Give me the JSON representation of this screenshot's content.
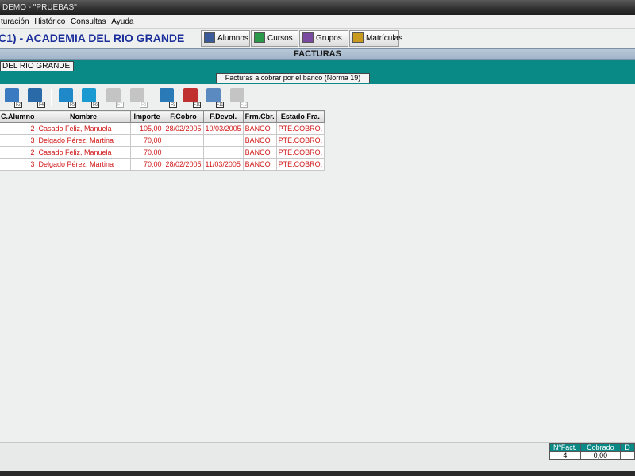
{
  "window": {
    "title": "DEMO - \"PRUEBAS\""
  },
  "menu": [
    "turación",
    "Histórico",
    "Consultas",
    "Ayuda"
  ],
  "header": {
    "title": "C1) - ACADEMIA DEL RIO GRANDE",
    "buttons": [
      {
        "label": "Alumnos",
        "icon": "students-icon",
        "color": "#3a5a9a"
      },
      {
        "label": "Cursos",
        "icon": "courses-icon",
        "color": "#2a9a4a"
      },
      {
        "label": "Grupos",
        "icon": "groups-icon",
        "color": "#7a4aa0"
      },
      {
        "label": "Matrículas",
        "icon": "enrollments-icon",
        "color": "#c89a20"
      }
    ]
  },
  "section": {
    "title": "FACTURAS"
  },
  "academy_tab": "DEL RIO GRANDE",
  "list_label": "Facturas a cobrar por el banco (Norma 19)",
  "toolbar": [
    {
      "key": "F2",
      "icon": "print-list-icon",
      "color": "#3a7ac0",
      "enabled": true
    },
    {
      "key": "F4",
      "icon": "sort-az-icon",
      "color": "#2a6aa8",
      "enabled": true
    },
    {
      "key": "F5",
      "icon": "edit-icon",
      "color": "#1e88c8",
      "enabled": true
    },
    {
      "key": "F6",
      "icon": "add-icon",
      "color": "#1a9ad0",
      "enabled": true
    },
    {
      "key": "F7",
      "icon": "disabled-action-icon",
      "color": "#c4c4c4",
      "enabled": false
    },
    {
      "key": "F8",
      "icon": "disabled-action-icon",
      "color": "#c4c4c4",
      "enabled": false
    },
    {
      "key": "F9",
      "icon": "export-icon",
      "color": "#2a7ab8",
      "enabled": true
    },
    {
      "key": "F10",
      "icon": "bank-remittance-icon",
      "color": "#c03030",
      "enabled": true
    },
    {
      "key": "F11",
      "icon": "printer-icon",
      "color": "#5a8ac0",
      "enabled": true
    },
    {
      "key": "F12",
      "icon": "disabled-action-icon",
      "color": "#c4c4c4",
      "enabled": false
    }
  ],
  "grid": {
    "columns": [
      "C.Alumno",
      "Nombre",
      "Importe",
      "F.Cobro",
      "F.Devol.",
      "Frm.Cbr.",
      "Estado Fra."
    ],
    "rows": [
      [
        "2",
        "Casado Feliz, Manuela",
        "105,00",
        "28/02/2005",
        "10/03/2005",
        "BANCO",
        "PTE.COBRO."
      ],
      [
        "3",
        "Delgado Pérez, Martina",
        "70,00",
        "",
        "",
        "BANCO",
        "PTE.COBRO."
      ],
      [
        "2",
        "Casado Feliz, Manuela",
        "70,00",
        "",
        "",
        "BANCO",
        "PTE.COBRO."
      ],
      [
        "3",
        "Delgado Pérez, Martina",
        "70,00",
        "28/02/2005",
        "11/03/2005",
        "BANCO",
        "PTE.COBRO."
      ]
    ]
  },
  "summary": {
    "headers": [
      "NºFact.",
      "Cobrado",
      "D"
    ],
    "values": [
      "4",
      "0,00",
      ""
    ]
  }
}
